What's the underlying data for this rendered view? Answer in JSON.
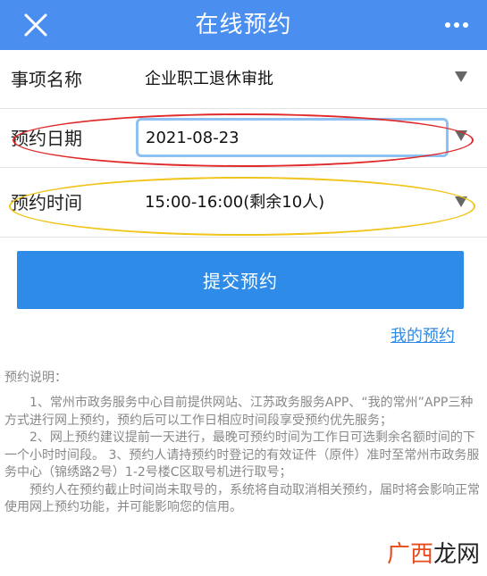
{
  "header": {
    "title": "在线预约"
  },
  "form": {
    "item_label": "事项名称",
    "item_value": "企业职工退休审批",
    "date_label": "预约日期",
    "date_value": "2021-08-23",
    "time_label": "预约时间",
    "time_value": "15:00-16:00(剩余10人)"
  },
  "actions": {
    "submit_label": "提交预约",
    "my_link": "我的预约"
  },
  "notes": {
    "title": "预约说明：",
    "paragraphs": [
      "1、常州市政务服务中心目前提供网站、江苏政务服务APP、“我的常州”APP三种方式进行网上预约，预约后可以工作日相应时间段享受预约优先服务；",
      "2、网上预约建议提前一天进行，最晚可预约时间为工作日可选剩余名额时间的下一个小时时间段。 3、预约人请持预约时登记的有效证件（原件）准时至常州市政务服务中心（锦绣路2号）1-2号楼C区取号机进行取号；",
      "预约人在预约截止时间尚未取号的，系统将自动取消相关预约，届时将会影响正常使用网上预约功能，并可能影响您的信用。"
    ]
  },
  "watermark": {
    "part1": "广西",
    "part2": "龙网"
  },
  "colors": {
    "header": "#4a8ff0",
    "button": "#2e8ce8",
    "annotation_red": "#e02a2a",
    "annotation_yellow": "#f0c419"
  }
}
